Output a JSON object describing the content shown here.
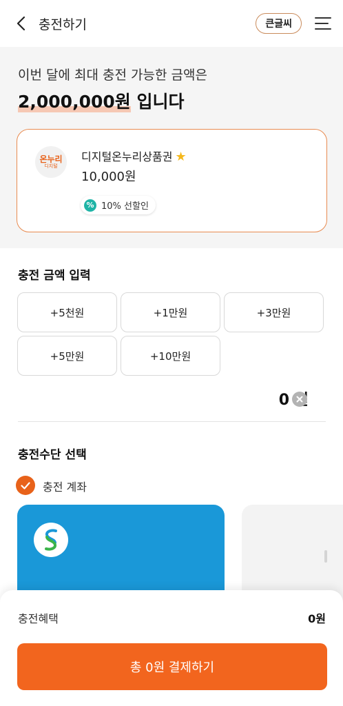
{
  "header": {
    "title": "충전하기",
    "big_font_label": "큰글씨"
  },
  "limit": {
    "line1": "이번 달에 최대 충전 가능한 금액은",
    "amount": "2,000,000원",
    "suffix": " 입니다"
  },
  "voucher": {
    "logo_main": "온누리",
    "logo_sub": "디지털",
    "name": "디지털온누리상품권",
    "price": "10,000원",
    "discount": "10% 선할인",
    "colors": {
      "accent": "#e88a4f",
      "discount_icon": "#1fb4a6",
      "star": "#f5b81c"
    }
  },
  "amount_section": {
    "title": "충전 금액 입력",
    "buttons": [
      "+5천원",
      "+1만원",
      "+3만원",
      "+5만원",
      "+10만원"
    ],
    "total": "0 원"
  },
  "method_section": {
    "title": "충전수단 선택",
    "option_label": "충전 계좌",
    "bank_card_color": "#1a98d8"
  },
  "bottom": {
    "benefit_label": "충전혜택",
    "benefit_value": "0원",
    "pay_label": "총 0원 결제하기",
    "pay_color": "#f2651e"
  }
}
